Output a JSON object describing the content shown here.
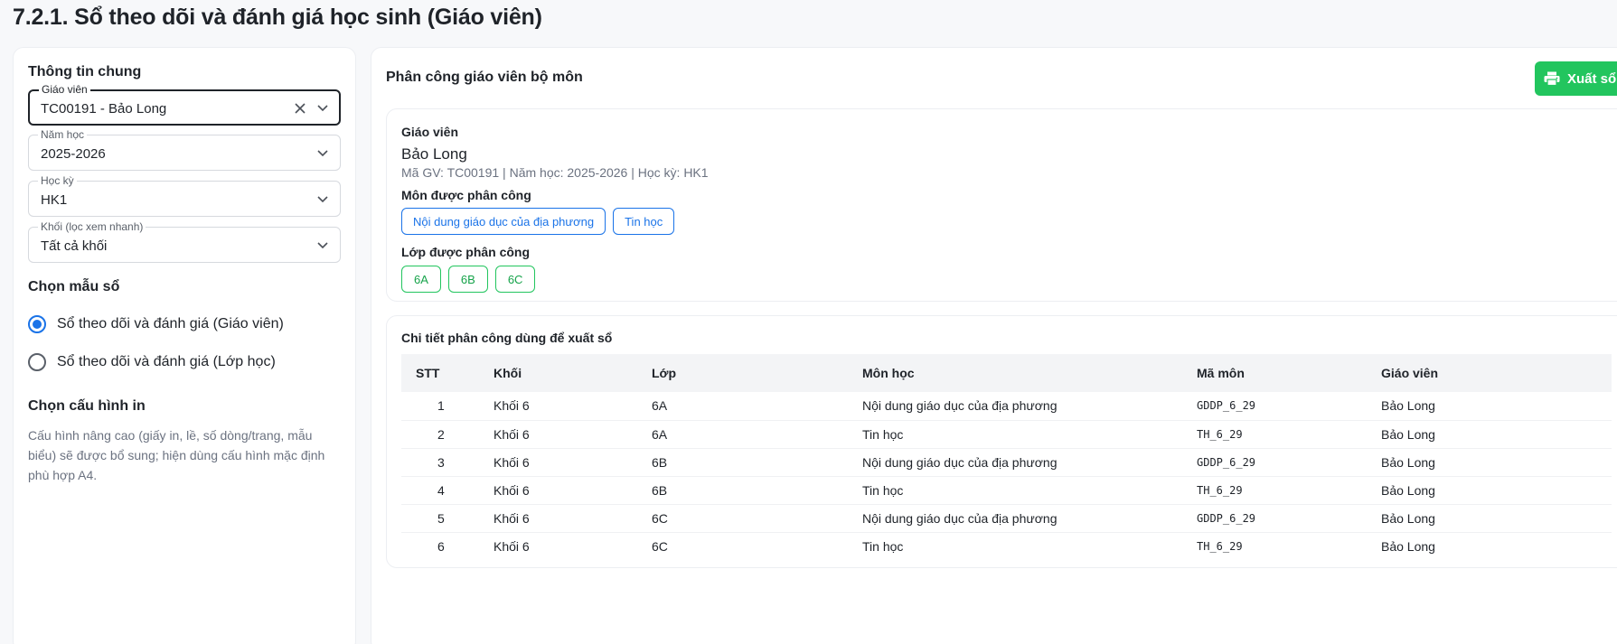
{
  "page": {
    "title": "7.2.1. Sổ theo dõi và đánh giá học sinh (Giáo viên)"
  },
  "left": {
    "general_title": "Thông tin chung",
    "fields": {
      "teacher": {
        "label": "Giáo viên",
        "value": "TC00191 - Bảo Long"
      },
      "year": {
        "label": "Năm học",
        "value": "2025-2026"
      },
      "term": {
        "label": "Học kỳ",
        "value": "HK1"
      },
      "grade": {
        "label": "Khối (lọc xem nhanh)",
        "value": "Tất cả khối"
      }
    },
    "template_title": "Chọn mẫu sổ",
    "templates": [
      {
        "label": "Sổ theo dõi và đánh giá (Giáo viên)",
        "checked": true
      },
      {
        "label": "Sổ theo dõi và đánh giá (Lớp học)",
        "checked": false
      }
    ],
    "print_title": "Chọn cấu hình in",
    "print_note": "Cấu hình nâng cao (giấy in, lề, số dòng/trang, mẫu biểu) sẽ được bổ sung; hiện dùng cấu hình mặc định phù hợp A4."
  },
  "right": {
    "title": "Phân công giáo viên bộ môn",
    "export_label": "Xuất sổ",
    "summary": {
      "teacher_label": "Giáo viên",
      "teacher_name": "Bảo Long",
      "meta": "Mã GV: TC00191 | Năm học: 2025-2026 | Học kỳ: HK1",
      "subjects_label": "Môn được phân công",
      "subjects": [
        "Nội dung giáo dục của địa phương",
        "Tin học"
      ],
      "classes_label": "Lớp được phân công",
      "classes": [
        "6A",
        "6B",
        "6C"
      ]
    },
    "detail": {
      "title": "Chi tiết phân công dùng để xuất sổ",
      "headers": [
        "STT",
        "Khối",
        "Lớp",
        "Môn học",
        "Mã môn",
        "Giáo viên"
      ],
      "rows": [
        [
          "1",
          "Khối 6",
          "6A",
          "Nội dung giáo dục của địa phương",
          "GDDP_6_29",
          "Bảo Long"
        ],
        [
          "2",
          "Khối 6",
          "6A",
          "Tin học",
          "TH_6_29",
          "Bảo Long"
        ],
        [
          "3",
          "Khối 6",
          "6B",
          "Nội dung giáo dục của địa phương",
          "GDDP_6_29",
          "Bảo Long"
        ],
        [
          "4",
          "Khối 6",
          "6B",
          "Tin học",
          "TH_6_29",
          "Bảo Long"
        ],
        [
          "5",
          "Khối 6",
          "6C",
          "Nội dung giáo dục của địa phương",
          "GDDP_6_29",
          "Bảo Long"
        ],
        [
          "6",
          "Khối 6",
          "6C",
          "Tin học",
          "TH_6_29",
          "Bảo Long"
        ]
      ]
    }
  },
  "colors": {
    "accent": "#1a73e8",
    "success": "#22c55e"
  }
}
